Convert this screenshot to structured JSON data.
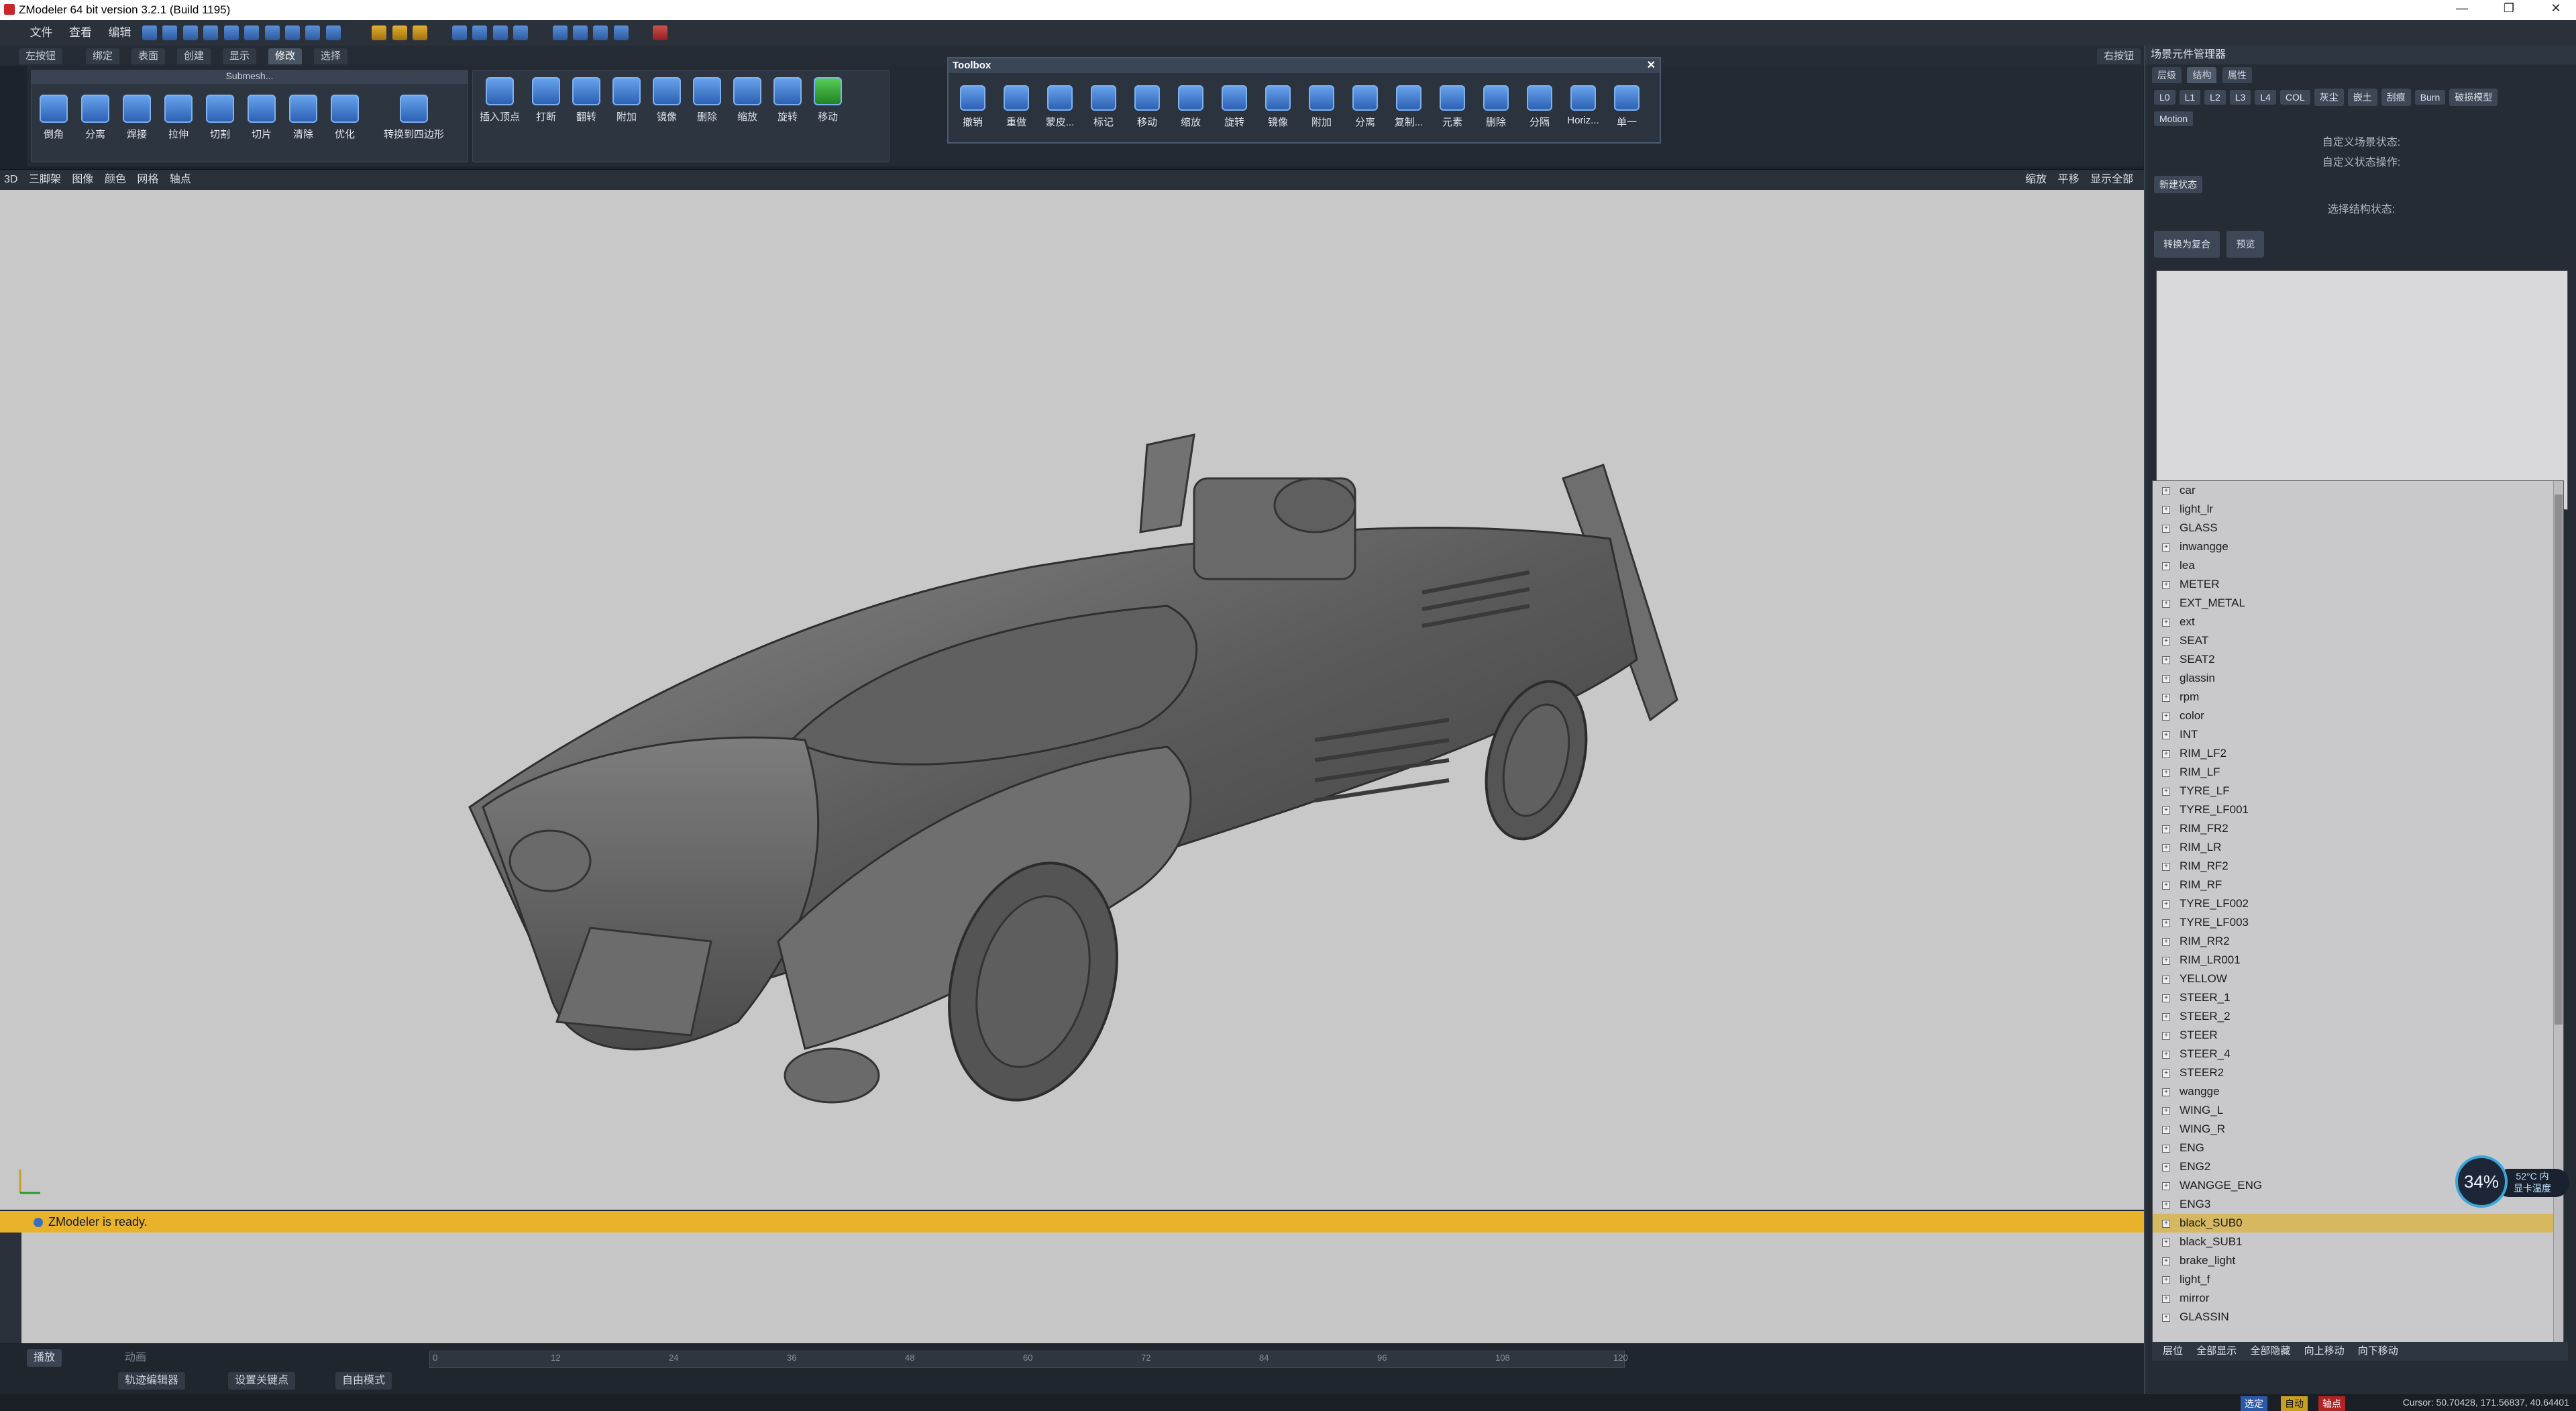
{
  "window": {
    "title": "ZModeler 64 bit version 3.2.1 (Build 1195)",
    "min": "—",
    "max": "❐",
    "close": "✕"
  },
  "menu": [
    "文件",
    "查看",
    "编辑"
  ],
  "left_tabs": {
    "left_button": "左按钮",
    "tabs": [
      "绑定",
      "表面",
      "创建",
      "显示",
      "修改",
      "选择"
    ],
    "right_button": "右按钮"
  },
  "ribbon": {
    "submesh_group_title": "Submesh...",
    "submesh_tools": [
      "倒角",
      "分离",
      "焊接",
      "拉伸",
      "切割",
      "切片",
      "清除",
      "优化",
      "转换到四边形"
    ],
    "vertex_tools": [
      "插入顶点",
      "打断",
      "翻转",
      "附加",
      "镜像",
      "删除",
      "缩放",
      "旋转",
      "移动"
    ]
  },
  "toolbox": {
    "title": "Toolbox",
    "tools": [
      "撤销",
      "重做",
      "蒙皮...",
      "标记",
      "移动",
      "缩放",
      "旋转",
      "镜像",
      "附加",
      "分离",
      "复制...",
      "元素",
      "删除",
      "分隔",
      "Horiz...",
      "单一"
    ]
  },
  "viewport_bar": {
    "mode": "3D",
    "items": [
      "三脚架",
      "图像",
      "颜色",
      "网格",
      "轴点"
    ],
    "right_items": [
      "缩放",
      "平移",
      "显示全部"
    ]
  },
  "status": {
    "message": "ZModeler is ready."
  },
  "timeline": {
    "buttons": [
      "播放",
      "轨迹编辑器",
      "设置关键点",
      "自由模式"
    ],
    "anim_label": "动画",
    "ticks": [
      "0",
      "12",
      "24",
      "36",
      "48",
      "60",
      "72",
      "84",
      "96",
      "108",
      "120"
    ]
  },
  "right_panel": {
    "title": "场景元件管理器",
    "tabs": [
      "层级",
      "结构",
      "属性"
    ],
    "lod_buttons": [
      "L0",
      "L1",
      "L2",
      "L3",
      "L4",
      "COL",
      "灰尘",
      "嵌土",
      "刮痕",
      "Burn",
      "破损模型"
    ],
    "motion": "Motion",
    "custom_state_label": "自定义场景状态:",
    "custom_state_ops": "自定义状态操作:",
    "new_state": "新建状态",
    "select_structure": "选择结构状态:",
    "convert_button": "转换为复合",
    "preview_button": "预览"
  },
  "scene_items": [
    "car",
    "light_lr",
    "GLASS",
    "inwangge",
    "lea",
    "METER",
    "EXT_METAL",
    "ext",
    "SEAT",
    "SEAT2",
    "glassin",
    "rpm",
    "color",
    "INT",
    "RIM_LF2",
    "RIM_LF",
    "TYRE_LF",
    "TYRE_LF001",
    "RIM_FR2",
    "RIM_LR",
    "RIM_RF2",
    "RIM_RF",
    "TYRE_LF002",
    "TYRE_LF003",
    "RIM_RR2",
    "RIM_LR001",
    "YELLOW",
    "STEER_1",
    "STEER_2",
    "STEER",
    "STEER_4",
    "STEER2",
    "wangge",
    "WING_L",
    "WING_R",
    "ENG",
    "ENG2",
    "WANGGE_ENG",
    "ENG3",
    "black_SUB0",
    "black_SUB1",
    "brake_light",
    "light_f",
    "mirror",
    "GLASSIN"
  ],
  "selected_item": "black_SUB0",
  "right_footer": [
    "层位",
    "全部显示",
    "全部隐藏",
    "向上移动",
    "向下移动"
  ],
  "gpu": {
    "percent": "34%",
    "temp": "52°C 内",
    "label": "显卡温度"
  },
  "bottom": {
    "buttons": [
      "选定",
      "自动",
      "轴点"
    ],
    "cursor": "Cursor: 50.70428, 171.56837, 40.64401"
  },
  "colors": {
    "status_bar": "#e8b32a",
    "selected_row": "#d5b860",
    "viewport_bg": "#c8c8c8"
  }
}
